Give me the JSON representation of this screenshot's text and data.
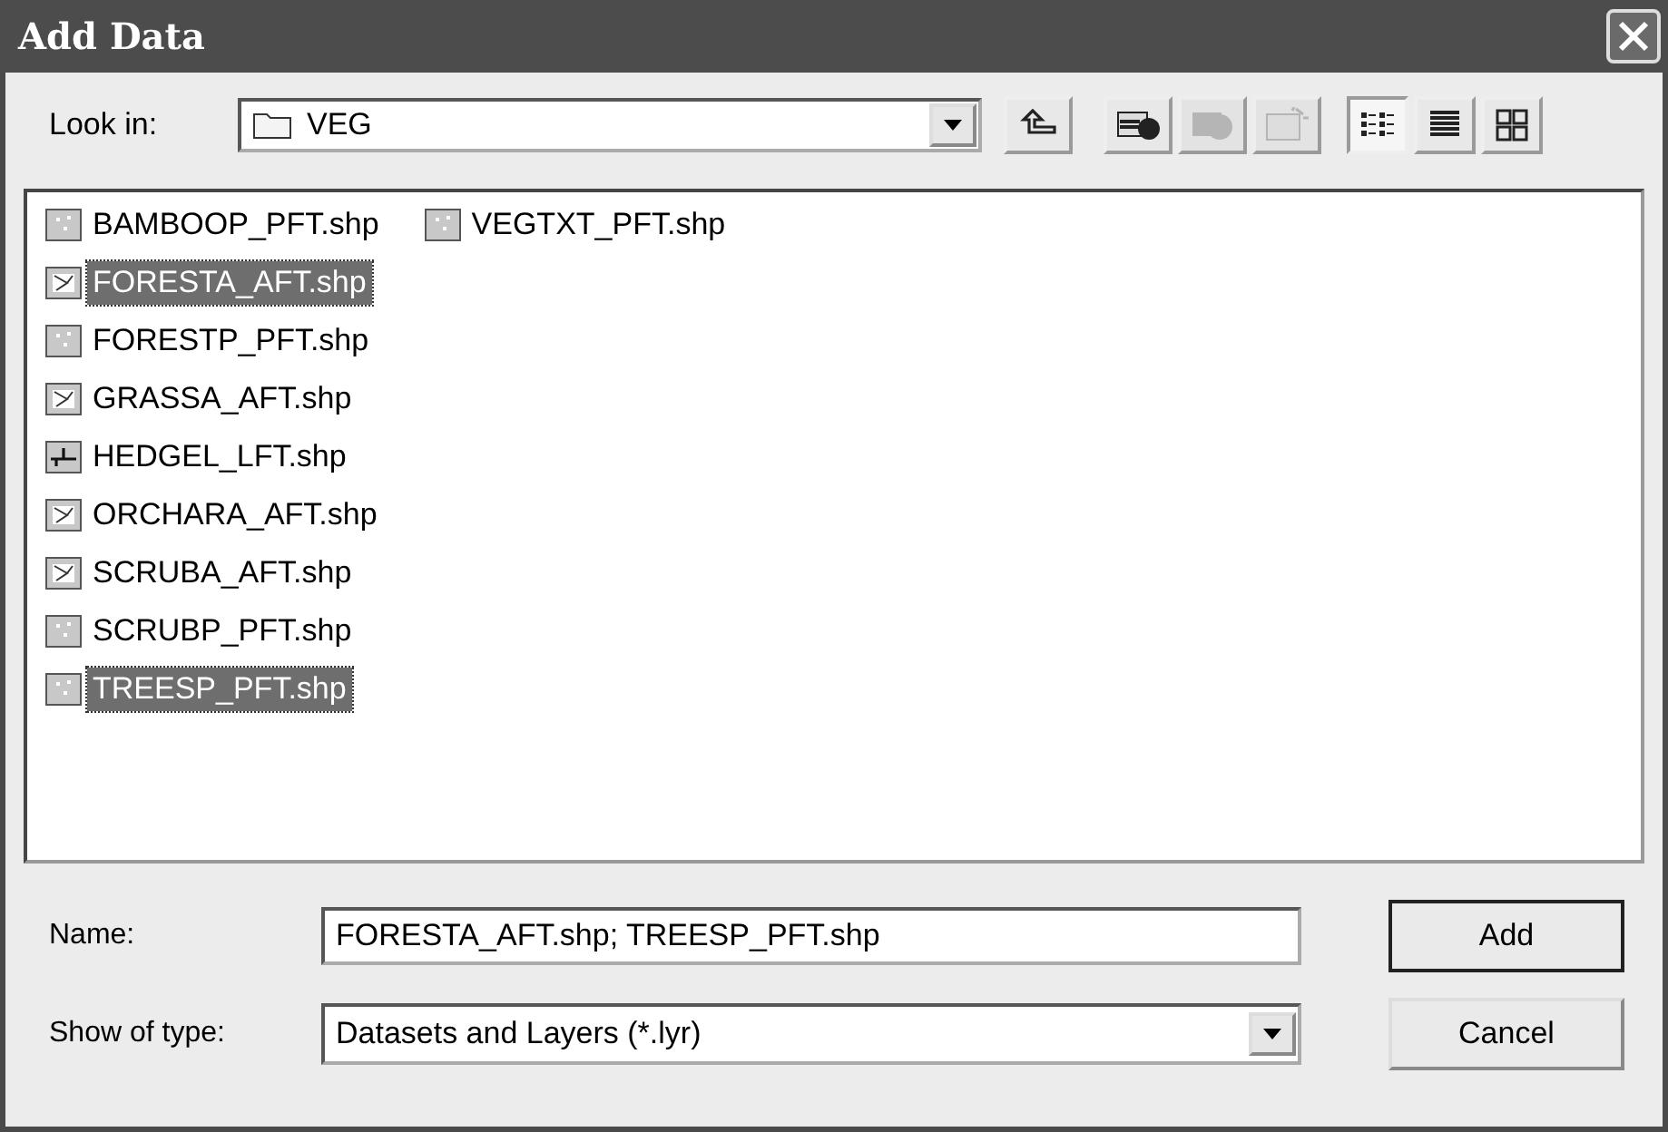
{
  "window": {
    "title": "Add Data"
  },
  "look_in": {
    "label": "Look in:",
    "value": "VEG"
  },
  "toolbar": [
    {
      "kind": "up",
      "disabled": false
    },
    {
      "kind": "connect",
      "disabled": false
    },
    {
      "kind": "disconnect",
      "disabled": true
    },
    {
      "kind": "new",
      "disabled": true
    }
  ],
  "views": [
    {
      "kind": "list",
      "selected": true
    },
    {
      "kind": "details",
      "selected": false
    },
    {
      "kind": "thumbnails",
      "selected": false
    }
  ],
  "files": [
    {
      "name": "BAMBOOP_PFT.shp",
      "kind": "point",
      "selected": false
    },
    {
      "name": "FORESTA_AFT.shp",
      "kind": "polygon",
      "selected": true
    },
    {
      "name": "FORESTP_PFT.shp",
      "kind": "point",
      "selected": false
    },
    {
      "name": "GRASSA_AFT.shp",
      "kind": "polygon",
      "selected": false
    },
    {
      "name": "HEDGEL_LFT.shp",
      "kind": "line",
      "selected": false
    },
    {
      "name": "ORCHARA_AFT.shp",
      "kind": "polygon",
      "selected": false
    },
    {
      "name": "SCRUBA_AFT.shp",
      "kind": "polygon",
      "selected": false
    },
    {
      "name": "SCRUBP_PFT.shp",
      "kind": "point",
      "selected": false
    },
    {
      "name": "TREESP_PFT.shp",
      "kind": "point",
      "selected": true
    },
    {
      "name": "VEGTXT_PFT.shp",
      "kind": "point",
      "selected": false
    }
  ],
  "name_field": {
    "label": "Name:",
    "value": "FORESTA_AFT.shp; TREESP_PFT.shp"
  },
  "type_field": {
    "label": "Show of type:",
    "value": "Datasets and Layers (*.lyr)"
  },
  "buttons": [
    {
      "label": "Add",
      "default": true
    },
    {
      "label": "Cancel",
      "default": false
    }
  ]
}
